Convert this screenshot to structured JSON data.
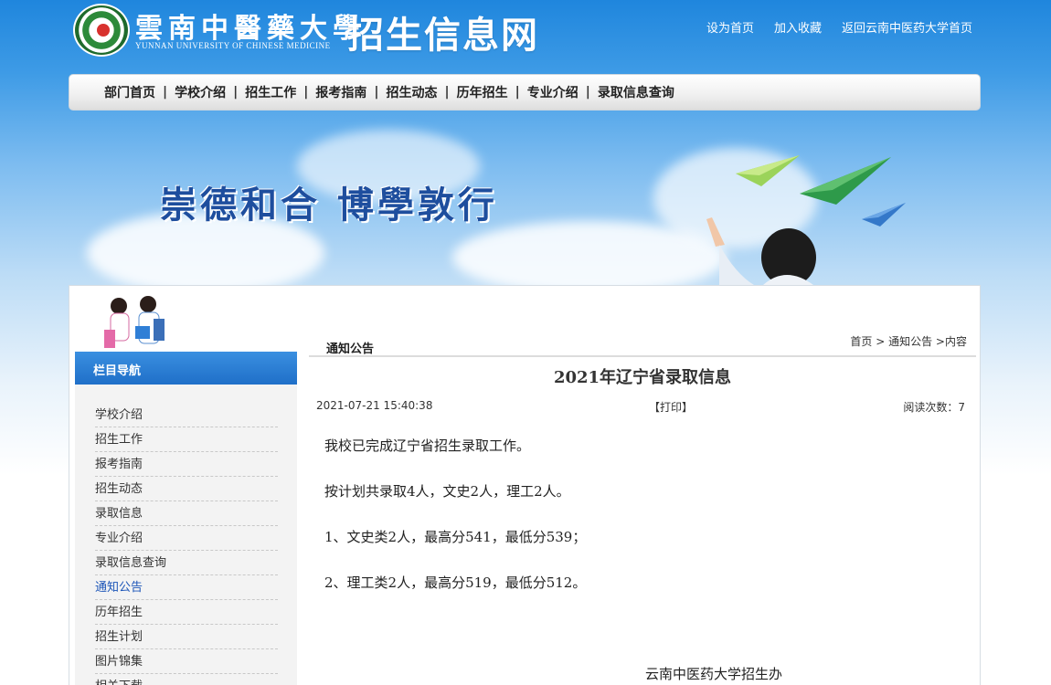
{
  "header": {
    "logo_cn": "雲南中醫藥大學",
    "logo_en": "YUNNAN UNIVERSITY OF CHINESE MEDICINE",
    "site_title": "招生信息网",
    "top_links": [
      "设为首页",
      "加入收藏",
      "返回云南中医药大学首页"
    ]
  },
  "nav": {
    "items": [
      "部门首页",
      "学校介绍",
      "招生工作",
      "报考指南",
      "招生动态",
      "历年招生",
      "专业介绍",
      "录取信息查询"
    ],
    "separator": "|"
  },
  "banner": {
    "slogan": "崇德和合  博學敦行"
  },
  "sidebar": {
    "heading": "栏目导航",
    "items": [
      "学校介绍",
      "招生工作",
      "报考指南",
      "招生动态",
      "录取信息",
      "专业介绍",
      "录取信息查询",
      "通知公告",
      "历年招生",
      "招生计划",
      "图片锦集",
      "相关下载"
    ],
    "active_index": 7,
    "active_color": "#1c55b8"
  },
  "content": {
    "section_title": "通知公告",
    "breadcrumb": {
      "home": "首页",
      "sep1": " > ",
      "section": "通知公告",
      "sep2": " >",
      "current": "内容"
    },
    "article": {
      "title": "2021年辽宁省录取信息",
      "date": "2021-07-21 15:40:38",
      "print_label": "【打印】",
      "reads_label": "阅读次数：",
      "reads_count": "7",
      "paragraphs": [
        "我校已完成辽宁省招生录取工作。",
        "按计划共录取4人，文史2人，理工2人。",
        "1、文史类2人，最高分541，最低分539；",
        "2、理工类2人，最高分519，最低分512。"
      ],
      "signature": "云南中医药大学招生办"
    }
  },
  "colors": {
    "header_blue": "#1f86dd",
    "sidebar_head": "#1f6fc8",
    "slogan": "#1e4e9e"
  }
}
